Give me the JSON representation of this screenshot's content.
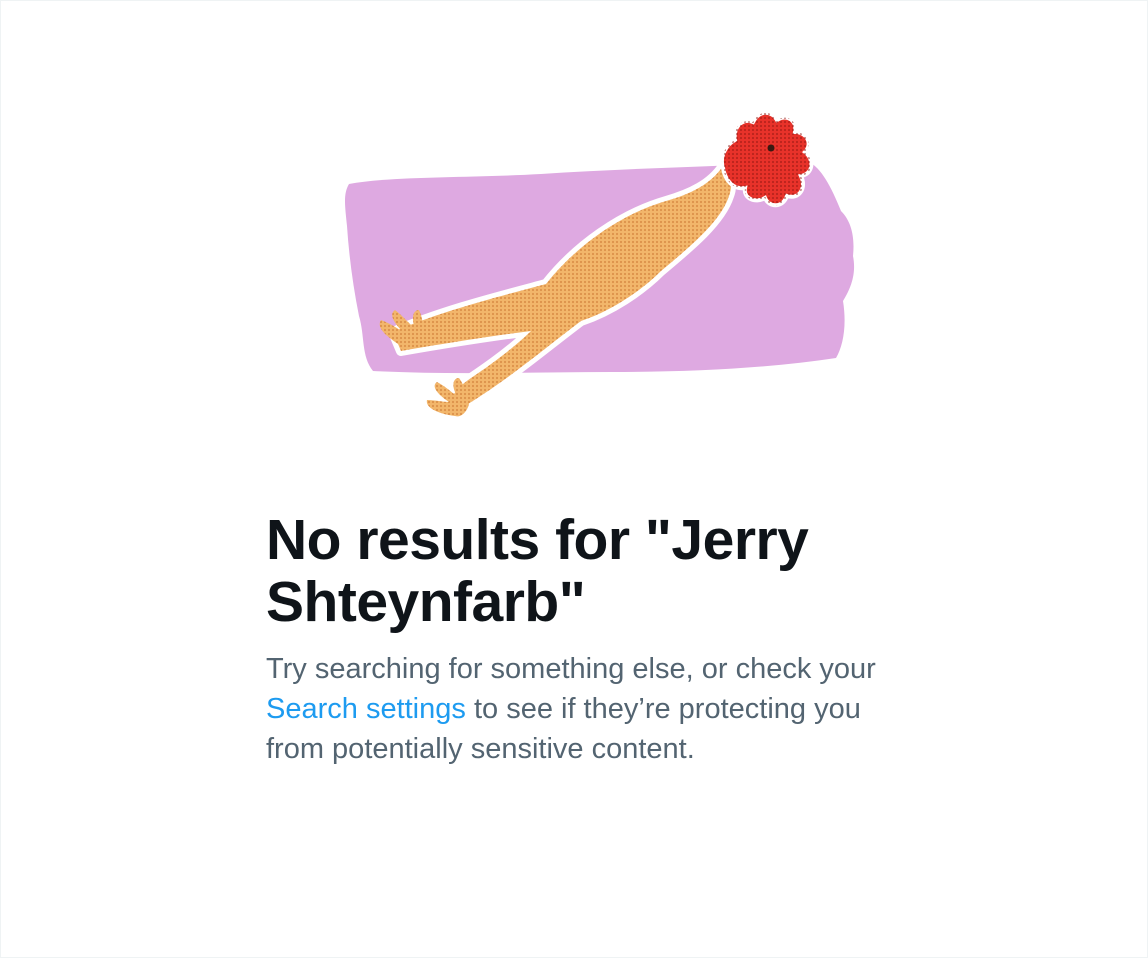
{
  "empty_state": {
    "illustration_icon": "rubber-chicken-illustration",
    "title": "No results for \"Jerry Shteynfarb\"",
    "body_before_link": "Try searching for something else, or check your ",
    "link_label": "Search settings",
    "body_after_link": " to see if they’re protecting you from potentially sensitive content."
  },
  "colors": {
    "background": "#ffffff",
    "title": "#0f1419",
    "body_text": "#536471",
    "link": "#1d9bf0",
    "swatch": "#dea9e1",
    "chicken_body": "#f2b66b",
    "chicken_comb": "#e8322a"
  }
}
